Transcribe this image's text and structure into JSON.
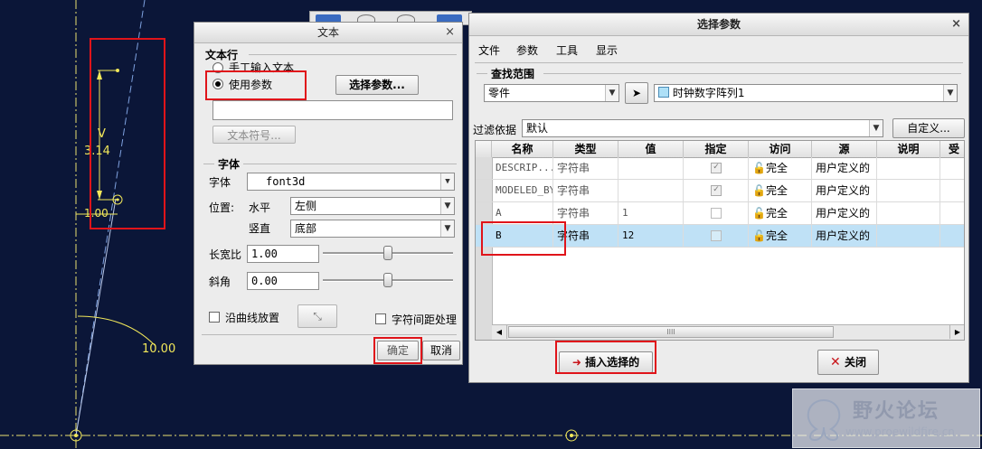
{
  "cad": {
    "dim_v": "V",
    "dim_value": "3.14",
    "dim_left": "1.00",
    "dim_angle": "10.00"
  },
  "text_dialog": {
    "title": "文本",
    "close": "×",
    "group_text_line": "文本行",
    "radio_manual": "手工输入文本",
    "radio_param": "使用参数",
    "select_param_btn": "选择参数...",
    "text_symbol_btn": "文本符号...",
    "group_font": "字体",
    "font_label": "字体",
    "font_value": "font3d",
    "position_label": "位置:",
    "horizontal_label": "水平",
    "horizontal_value": "左侧",
    "vertical_label": "竖直",
    "vertical_value": "底部",
    "aspect_label": "长宽比",
    "aspect_value": "1.00",
    "slant_label": "斜角",
    "slant_value": "0.00",
    "along_curve": "沿曲线放置",
    "kerning": "字符间距处理",
    "ok": "确定",
    "cancel": "取消"
  },
  "param_dialog": {
    "title": "选择参数",
    "close": "×",
    "menu": [
      "文件",
      "参数",
      "工具",
      "显示"
    ],
    "search_scope": "查找范围",
    "scope_value": "零件",
    "object_value": "时钟数字阵列1",
    "filter_label": "过滤依据",
    "filter_value": "默认",
    "customize_btn": "自定义...",
    "columns": [
      "名称",
      "类型",
      "值",
      "指定",
      "访问",
      "源",
      "说明",
      "受"
    ],
    "rows": [
      {
        "name": "DESCRIP...",
        "type": "字符串",
        "value": "",
        "access": "完全",
        "source": "用户定义的"
      },
      {
        "name": "MODELED_BY",
        "type": "字符串",
        "value": "",
        "access": "完全",
        "source": "用户定义的"
      },
      {
        "name": "A",
        "type": "字符串",
        "value": "1",
        "access": "完全",
        "source": "用户定义的"
      },
      {
        "name": "B",
        "type": "字符串",
        "value": "12",
        "access": "完全",
        "source": "用户定义的"
      }
    ],
    "insert_btn": "插入选择的",
    "close_btn": "关闭"
  },
  "watermark": {
    "name": "野火论坛",
    "url": "www.proewildfire.cn"
  },
  "colors": {
    "canvas": "#0b1638",
    "cad_yellow": "#f2e85a",
    "highlight_red": "#e0141a",
    "selected_row": "#bfe1f6"
  }
}
